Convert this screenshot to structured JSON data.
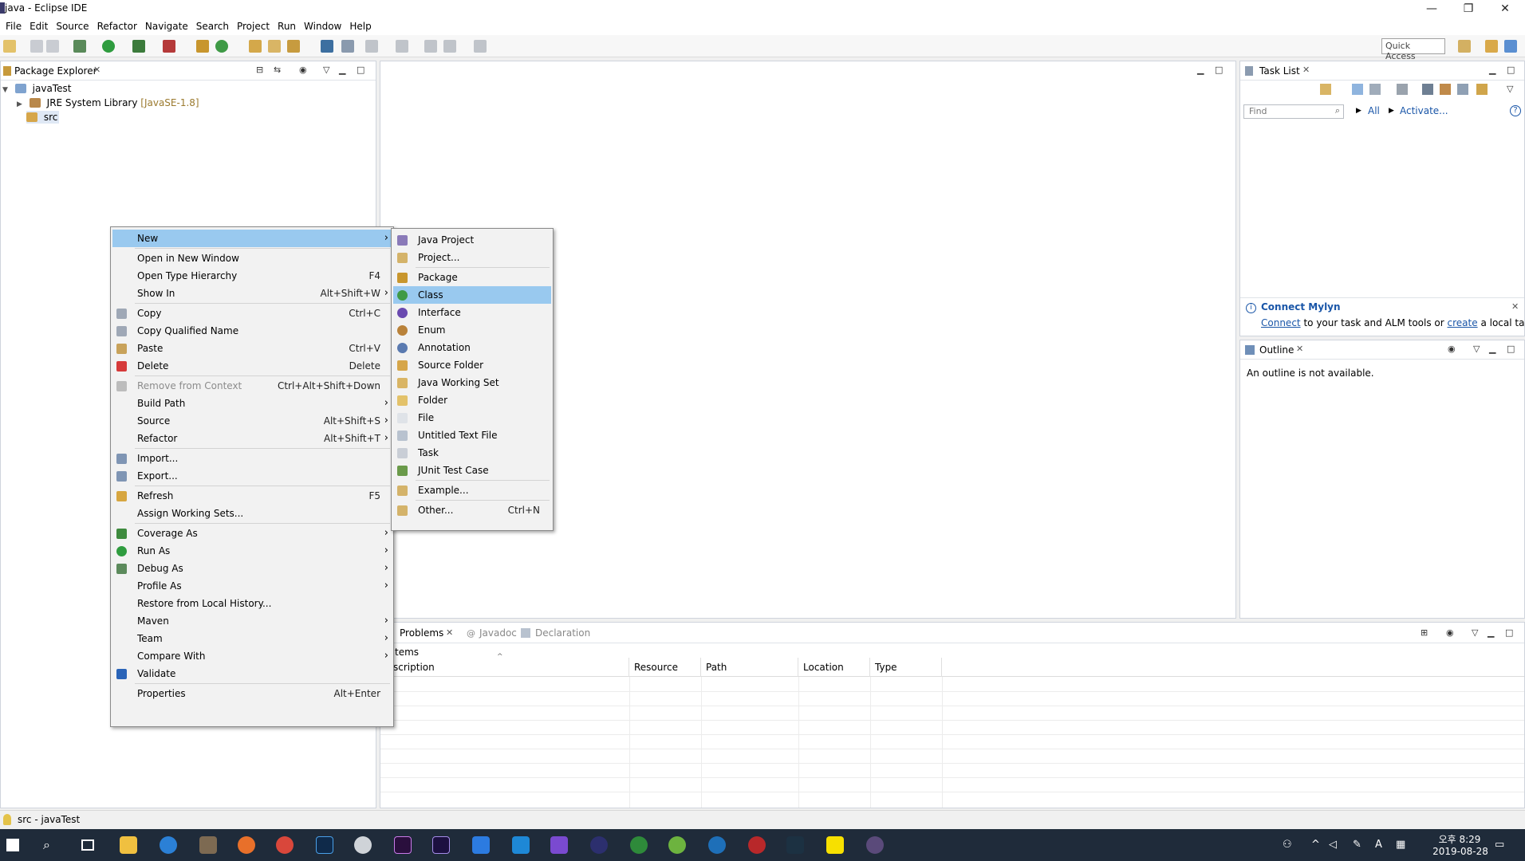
{
  "window": {
    "title": "java - Eclipse IDE",
    "minimize_glyph": "—",
    "restore_glyph": "❐",
    "close_glyph": "✕"
  },
  "menubar": [
    "File",
    "Edit",
    "Source",
    "Refactor",
    "Navigate",
    "Search",
    "Project",
    "Run",
    "Window",
    "Help"
  ],
  "toolbar": {
    "quick_access_placeholder": "Quick Access"
  },
  "package_explorer": {
    "tab_label": "Package Explorer",
    "tree": {
      "project": "javaTest",
      "library": "JRE System Library",
      "library_suffix": "[JavaSE-1.8]",
      "src": "src"
    }
  },
  "task_list": {
    "tab_label": "Task List",
    "find_placeholder": "Find",
    "all_label": "All",
    "activate_label": "Activate...",
    "help_glyph": "?"
  },
  "mylyn": {
    "title": "Connect Mylyn",
    "connect_link": "Connect",
    "middle_text": "to your task and ALM tools or",
    "create_link": "create",
    "end_text": "a local task."
  },
  "outline": {
    "tab_label": "Outline",
    "message": "An outline is not available."
  },
  "bottom_panel": {
    "tabs": [
      "Problems",
      "Javadoc",
      "Declaration"
    ],
    "items_label": "tems",
    "columns": [
      "scription",
      "Resource",
      "Path",
      "Location",
      "Type"
    ]
  },
  "context_menu": {
    "groups": [
      [
        {
          "label": "New",
          "shortcut": "",
          "arrow": true,
          "highlight": true
        }
      ],
      [
        {
          "label": "Open in New Window",
          "shortcut": ""
        },
        {
          "label": "Open Type Hierarchy",
          "shortcut": "F4"
        },
        {
          "label": "Show In",
          "shortcut": "Alt+Shift+W",
          "arrow": true
        }
      ],
      [
        {
          "label": "Copy",
          "shortcut": "Ctrl+C",
          "icon": "copy-icon"
        },
        {
          "label": "Copy Qualified Name",
          "shortcut": "",
          "icon": "copy-qualified-icon"
        },
        {
          "label": "Paste",
          "shortcut": "Ctrl+V",
          "icon": "paste-icon"
        },
        {
          "label": "Delete",
          "shortcut": "Delete",
          "icon": "delete-icon"
        }
      ],
      [
        {
          "label": "Remove from Context",
          "shortcut": "Ctrl+Alt+Shift+Down",
          "disabled": true,
          "icon": "remove-context-icon"
        },
        {
          "label": "Build Path",
          "shortcut": "",
          "arrow": true
        },
        {
          "label": "Source",
          "shortcut": "Alt+Shift+S",
          "arrow": true
        },
        {
          "label": "Refactor",
          "shortcut": "Alt+Shift+T",
          "arrow": true
        }
      ],
      [
        {
          "label": "Import...",
          "shortcut": "",
          "icon": "import-icon"
        },
        {
          "label": "Export...",
          "shortcut": "",
          "icon": "export-icon"
        }
      ],
      [
        {
          "label": "Refresh",
          "shortcut": "F5",
          "icon": "refresh-icon"
        },
        {
          "label": "Assign Working Sets...",
          "shortcut": ""
        }
      ],
      [
        {
          "label": "Coverage As",
          "shortcut": "",
          "arrow": true,
          "icon": "coverage-icon"
        },
        {
          "label": "Run As",
          "shortcut": "",
          "arrow": true,
          "icon": "run-icon"
        },
        {
          "label": "Debug As",
          "shortcut": "",
          "arrow": true,
          "icon": "debug-icon"
        },
        {
          "label": "Profile As",
          "shortcut": "",
          "arrow": true
        },
        {
          "label": "Restore from Local History...",
          "shortcut": ""
        },
        {
          "label": "Maven",
          "shortcut": "",
          "arrow": true
        },
        {
          "label": "Team",
          "shortcut": "",
          "arrow": true
        },
        {
          "label": "Compare With",
          "shortcut": "",
          "arrow": true
        },
        {
          "label": "Validate",
          "shortcut": "",
          "icon": "checkbox-icon"
        }
      ],
      [
        {
          "label": "Properties",
          "shortcut": "Alt+Enter"
        }
      ]
    ]
  },
  "submenu_new": {
    "groups": [
      [
        {
          "label": "Java Project",
          "icon": "java-project-icon"
        },
        {
          "label": "Project...",
          "icon": "project-icon"
        }
      ],
      [
        {
          "label": "Package",
          "icon": "package-icon"
        },
        {
          "label": "Class",
          "icon": "class-icon",
          "highlight": true
        },
        {
          "label": "Interface",
          "icon": "interface-icon"
        },
        {
          "label": "Enum",
          "icon": "enum-icon"
        },
        {
          "label": "Annotation",
          "icon": "annotation-icon"
        },
        {
          "label": "Source Folder",
          "icon": "source-folder-icon"
        },
        {
          "label": "Java Working Set",
          "icon": "working-set-icon"
        },
        {
          "label": "Folder",
          "icon": "folder-icon"
        },
        {
          "label": "File",
          "icon": "file-icon"
        },
        {
          "label": "Untitled Text File",
          "icon": "text-file-icon"
        },
        {
          "label": "Task",
          "icon": "task-icon"
        },
        {
          "label": "JUnit Test Case",
          "icon": "junit-icon"
        }
      ],
      [
        {
          "label": "Example...",
          "icon": "example-icon"
        }
      ],
      [
        {
          "label": "Other...",
          "icon": "other-icon",
          "shortcut": "Ctrl+N"
        }
      ]
    ]
  },
  "statusbar": {
    "text": "src - javaTest"
  },
  "taskbar": {
    "time": "오후 8:29",
    "date": "2019-08-28",
    "ime": "A"
  },
  "colors": {
    "highlight": "#99c9ef",
    "link": "#1a56a8",
    "library_suffix": "#9b7a2e"
  }
}
